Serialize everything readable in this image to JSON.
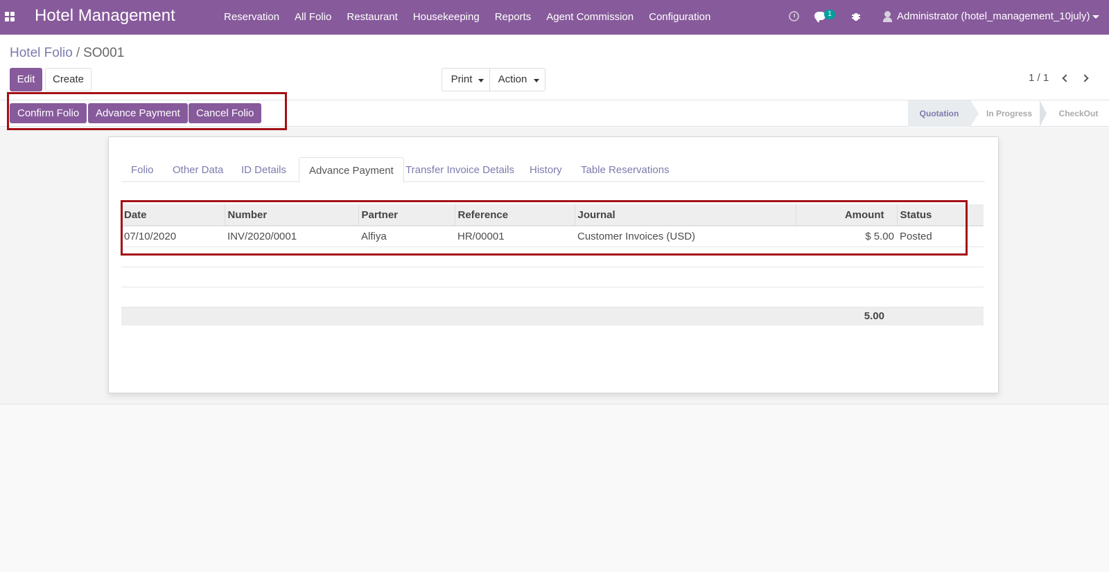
{
  "navbar": {
    "brand": "Hotel Management",
    "menu": [
      "Reservation",
      "All Folio",
      "Restaurant",
      "Housekeeping",
      "Reports",
      "Agent Commission",
      "Configuration"
    ],
    "message_count": "1",
    "user": "Administrator (hotel_management_10july)",
    "color": "#875a9b"
  },
  "breadcrumb": {
    "parent": "Hotel Folio",
    "separator": "/",
    "current": "SO001"
  },
  "buttons": {
    "edit": "Edit",
    "create": "Create",
    "print": "Print",
    "action": "Action"
  },
  "pager": {
    "value": "1 / 1"
  },
  "statusbar": {
    "buttons": [
      "Confirm Folio",
      "Advance Payment",
      "Cancel Folio"
    ],
    "stages": [
      "Quotation",
      "In Progress",
      "CheckOut"
    ],
    "active_stage": "Quotation"
  },
  "tabs": [
    "Folio",
    "Other Data",
    "ID Details",
    "Advance Payment",
    "Transfer Invoice Details",
    "History",
    "Table Reservations"
  ],
  "active_tab": "Advance Payment",
  "payments_table": {
    "columns": [
      "Date",
      "Number",
      "Partner",
      "Reference",
      "Journal",
      "Amount",
      "Status"
    ],
    "rows": [
      [
        "07/10/2020",
        "INV/2020/0001",
        "Alfiya",
        "HR/00001",
        "Customer Invoices (USD)",
        "$ 5.00",
        "Posted"
      ]
    ],
    "total": "5.00"
  }
}
